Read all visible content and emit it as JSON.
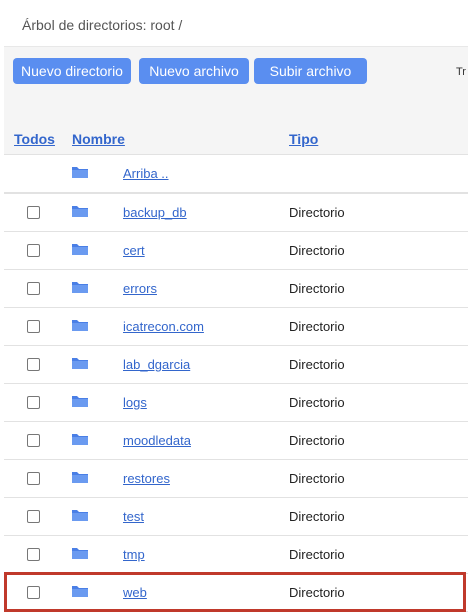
{
  "breadcrumb": "Árbol de directorios: root /",
  "toolbar": {
    "new_dir_label": "Nuevo directorio",
    "new_file_label": "Nuevo archivo",
    "upload_label": "Subir archivo",
    "cut_text": "Tr"
  },
  "columns": {
    "all": "Todos",
    "name": "Nombre",
    "type": "Tipo"
  },
  "up_row": {
    "name": "Arriba .."
  },
  "rows": [
    {
      "name": "backup_db",
      "type": "Directorio"
    },
    {
      "name": "cert",
      "type": "Directorio"
    },
    {
      "name": "errors",
      "type": "Directorio"
    },
    {
      "name": "icatrecon.com",
      "type": "Directorio"
    },
    {
      "name": "lab_dgarcia",
      "type": "Directorio"
    },
    {
      "name": "logs",
      "type": "Directorio"
    },
    {
      "name": "moodledata",
      "type": "Directorio"
    },
    {
      "name": "restores",
      "type": "Directorio"
    },
    {
      "name": "test",
      "type": "Directorio"
    },
    {
      "name": "tmp",
      "type": "Directorio"
    },
    {
      "name": "web",
      "type": "Directorio"
    }
  ],
  "colors": {
    "button": "#5a8ef0",
    "link": "#3366cc",
    "highlight": "#c0392b"
  }
}
